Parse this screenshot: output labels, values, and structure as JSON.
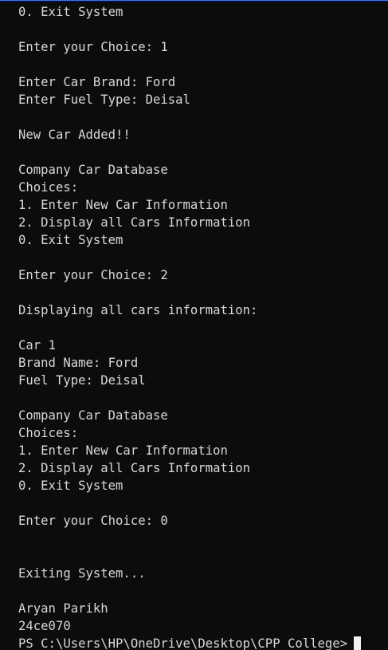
{
  "terminal": {
    "lines": [
      "0. Exit System",
      "",
      "Enter your Choice: 1",
      "",
      "Enter Car Brand: Ford",
      "Enter Fuel Type: Deisal",
      "",
      "New Car Added!!",
      "",
      "Company Car Database",
      "Choices:",
      "1. Enter New Car Information",
      "2. Display all Cars Information",
      "0. Exit System",
      "",
      "Enter your Choice: 2",
      "",
      "Displaying all cars information:",
      "",
      "Car 1",
      "Brand Name: Ford",
      "Fuel Type: Deisal",
      "",
      "Company Car Database",
      "Choices:",
      "1. Enter New Car Information",
      "2. Display all Cars Information",
      "0. Exit System",
      "",
      "Enter your Choice: 0",
      "",
      "",
      "Exiting System...",
      "",
      "Aryan Parikh",
      "24ce070"
    ],
    "prompt": "PS C:\\Users\\HP\\OneDrive\\Desktop\\CPP College>"
  },
  "colors": {
    "background": "#0c0c0c",
    "text": "#d8d8d8",
    "cursor": "#f2f2f2",
    "top_border": "#3b78d8"
  }
}
